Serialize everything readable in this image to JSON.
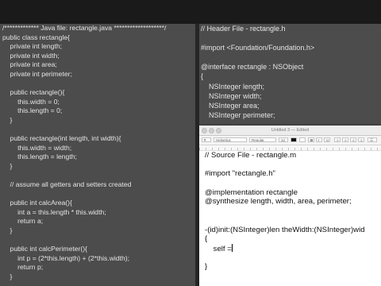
{
  "left_pane": {
    "lines": [
      "/************* Java file: rectangle.java *******************/",
      "public class rectangle{",
      "    private int length;",
      "    private int width;",
      "    private int area;",
      "    private int perimeter;",
      "",
      "    public rectangle(){",
      "        this.width = 0;",
      "        this.length = 0;",
      "    }",
      "",
      "    public rectangle(int length, int width){",
      "        this.width = width;",
      "        this.length = length;",
      "    }",
      "",
      "    // assume all getters and setters created",
      "",
      "    public int calcArea(){",
      "        int a = this.length * this.width;",
      "        return a;",
      "    }",
      "",
      "    public int calcPerimeter(){",
      "        int p = (2*this.length) + (2*this.width);",
      "        return p;",
      "    }"
    ]
  },
  "right_pane": {
    "lines": [
      "// Header File - rectangle.h",
      "",
      "#import <Foundation/Foundation.h>",
      "",
      "@interface rectangle : NSObject",
      "{",
      "    NSInteger length;",
      "    NSInteger width;",
      "    NSInteger area;",
      "    NSInteger perimeter;"
    ]
  },
  "textedit": {
    "title": "Untitled 3 — Edited",
    "toolbar": {
      "font_family": "Helvetica",
      "font_style": "Regular",
      "font_size": "12"
    },
    "lines": [
      "// Source File - rectangle.m",
      "",
      "#import \"rectangle.h\"",
      "",
      "@implementation rectangle",
      "@synthesize length, width, area, perimeter;",
      "",
      "",
      "-(id)init:(NSInteger)len theWidth:(NSInteger)wid",
      "{",
      "    self =",
      "",
      "}"
    ]
  },
  "colors": {
    "editor_bg": "#4c4c4c",
    "editor_text": "#e4e4e4",
    "textedit_bg": "#ffffff"
  }
}
